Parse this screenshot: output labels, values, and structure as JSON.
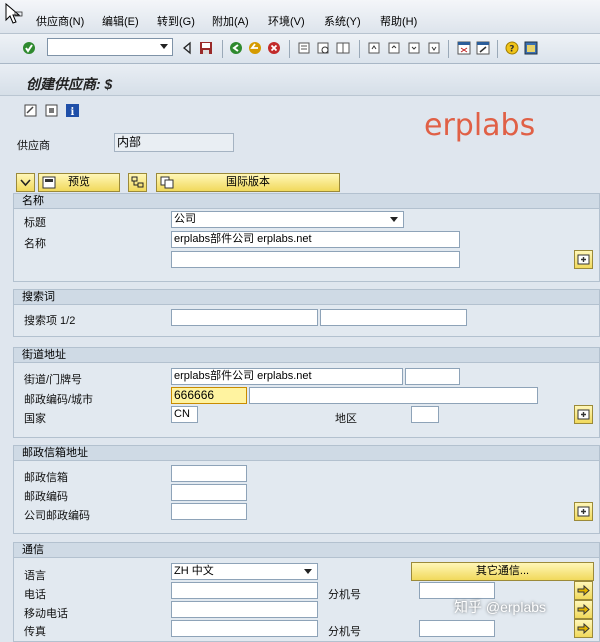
{
  "menu": {
    "items": [
      "供应商(N)",
      "编辑(E)",
      "转到(G)",
      "附加(A)",
      "环境(V)",
      "系统(Y)",
      "帮助(H)"
    ]
  },
  "window": {
    "title": "创建供应商: $"
  },
  "watermark": "erplabs",
  "vendor": {
    "label": "供应商",
    "value": "内部"
  },
  "buttons": {
    "preview": "预览",
    "intl_version": "国际版本",
    "other_comm": "其它通信..."
  },
  "sections": {
    "name": {
      "header": "名称",
      "title_label": "标题",
      "title_value": "公司",
      "name_label": "名称",
      "name_value": "erplabs部件公司 erplabs.net",
      "name2_value": ""
    },
    "search": {
      "header": "搜索词",
      "term_label": "搜索项 1/2",
      "term1": "",
      "term2": ""
    },
    "street": {
      "header": "街道地址",
      "street_label": "街道/门牌号",
      "street_value": "erplabs部件公司 erplabs.net",
      "house_no": "",
      "postal_label": "邮政编码/城市",
      "postal_value": "666666",
      "city_value": "",
      "country_label": "国家",
      "country_value": "CN",
      "region_label": "地区",
      "region_value": ""
    },
    "pobox": {
      "header": "邮政信箱地址",
      "pobox_label": "邮政信箱",
      "postal_label": "邮政编码",
      "company_postal_label": "公司邮政编码"
    },
    "comm": {
      "header": "通信",
      "language_label": "语言",
      "language_value": "ZH 中文",
      "phone_label": "电话",
      "ext_label": "分机号",
      "mobile_label": "移动电话",
      "fax_label": "传真",
      "ext2_label": "分机号"
    }
  },
  "footer_watermark": "知乎 @erplabs",
  "colors": {
    "accent_button": "#f1d95c",
    "focus_field": "#fff3a0",
    "watermark": "#e06046"
  }
}
